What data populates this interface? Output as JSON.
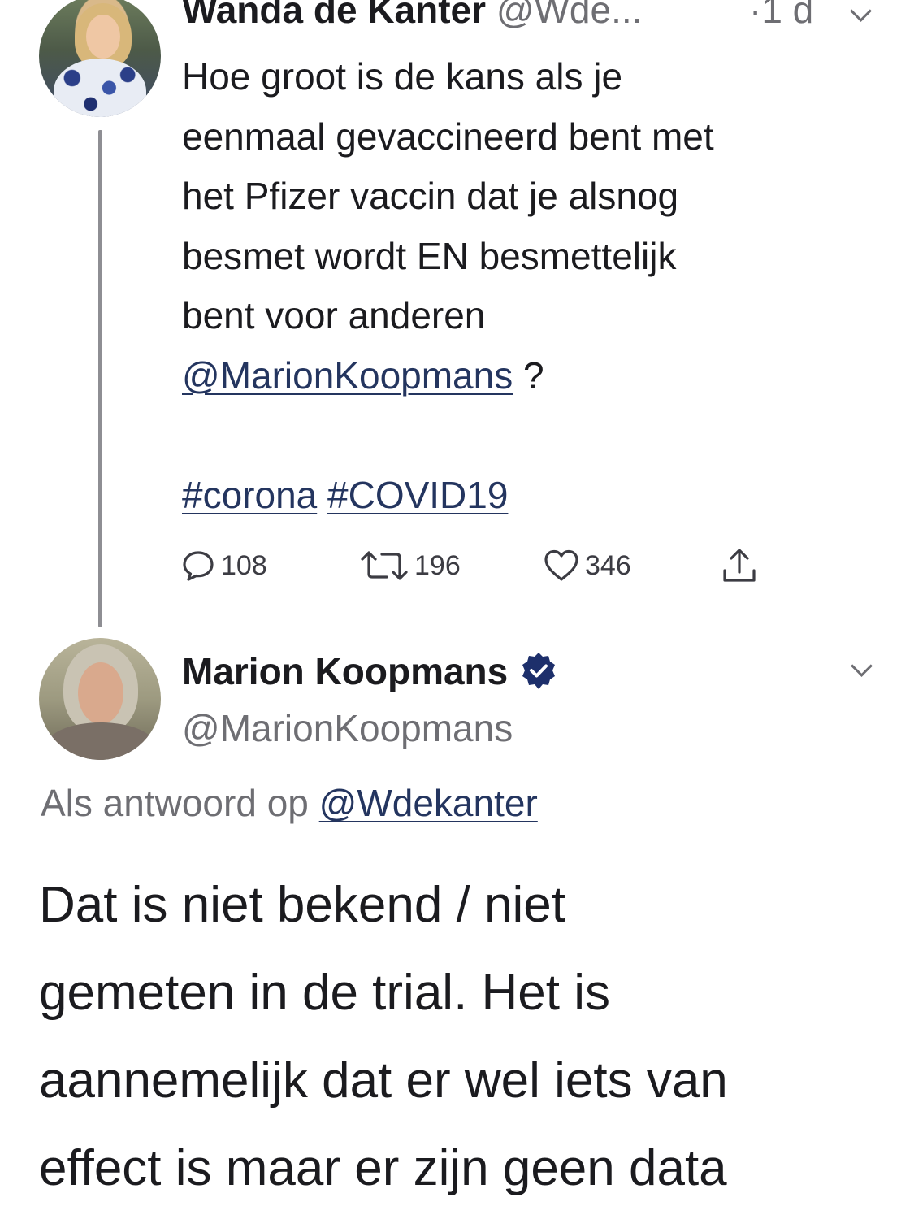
{
  "tweet1": {
    "author_name": "Wanda de Kanter",
    "author_handle": "@Wde...",
    "time": "·1 d",
    "text_lines": [
      "Hoe groot is de kans als je",
      "eenmaal gevaccineerd bent met",
      "het Pfizer vaccin dat je alsnog",
      "besmet wordt EN besmettelijk",
      "bent voor anderen"
    ],
    "mention": "@MarionKoopmans",
    "mention_suffix": " ?",
    "hashtags": [
      "#corona",
      "#COVID19"
    ],
    "stats": {
      "replies": "108",
      "retweets": "196",
      "likes": "346"
    }
  },
  "tweet2": {
    "author_name": "Marion Koopmans",
    "author_handle": "@MarionKoopmans",
    "reply_prefix": "Als antwoord op ",
    "reply_handle": "@Wdekanter",
    "text_lines": [
      "Dat is niet bekend / niet",
      "gemeten in de trial. Het is",
      "aannemelijk dat er wel iets van",
      "effect is maar er zijn geen data"
    ]
  },
  "colors": {
    "link": "#24355f",
    "verified": "#1d2f6b",
    "muted": "#6e6e73"
  },
  "icons": [
    "reply-icon",
    "retweet-icon",
    "like-icon",
    "share-icon",
    "verified-badge-icon",
    "chevron-down-icon"
  ]
}
